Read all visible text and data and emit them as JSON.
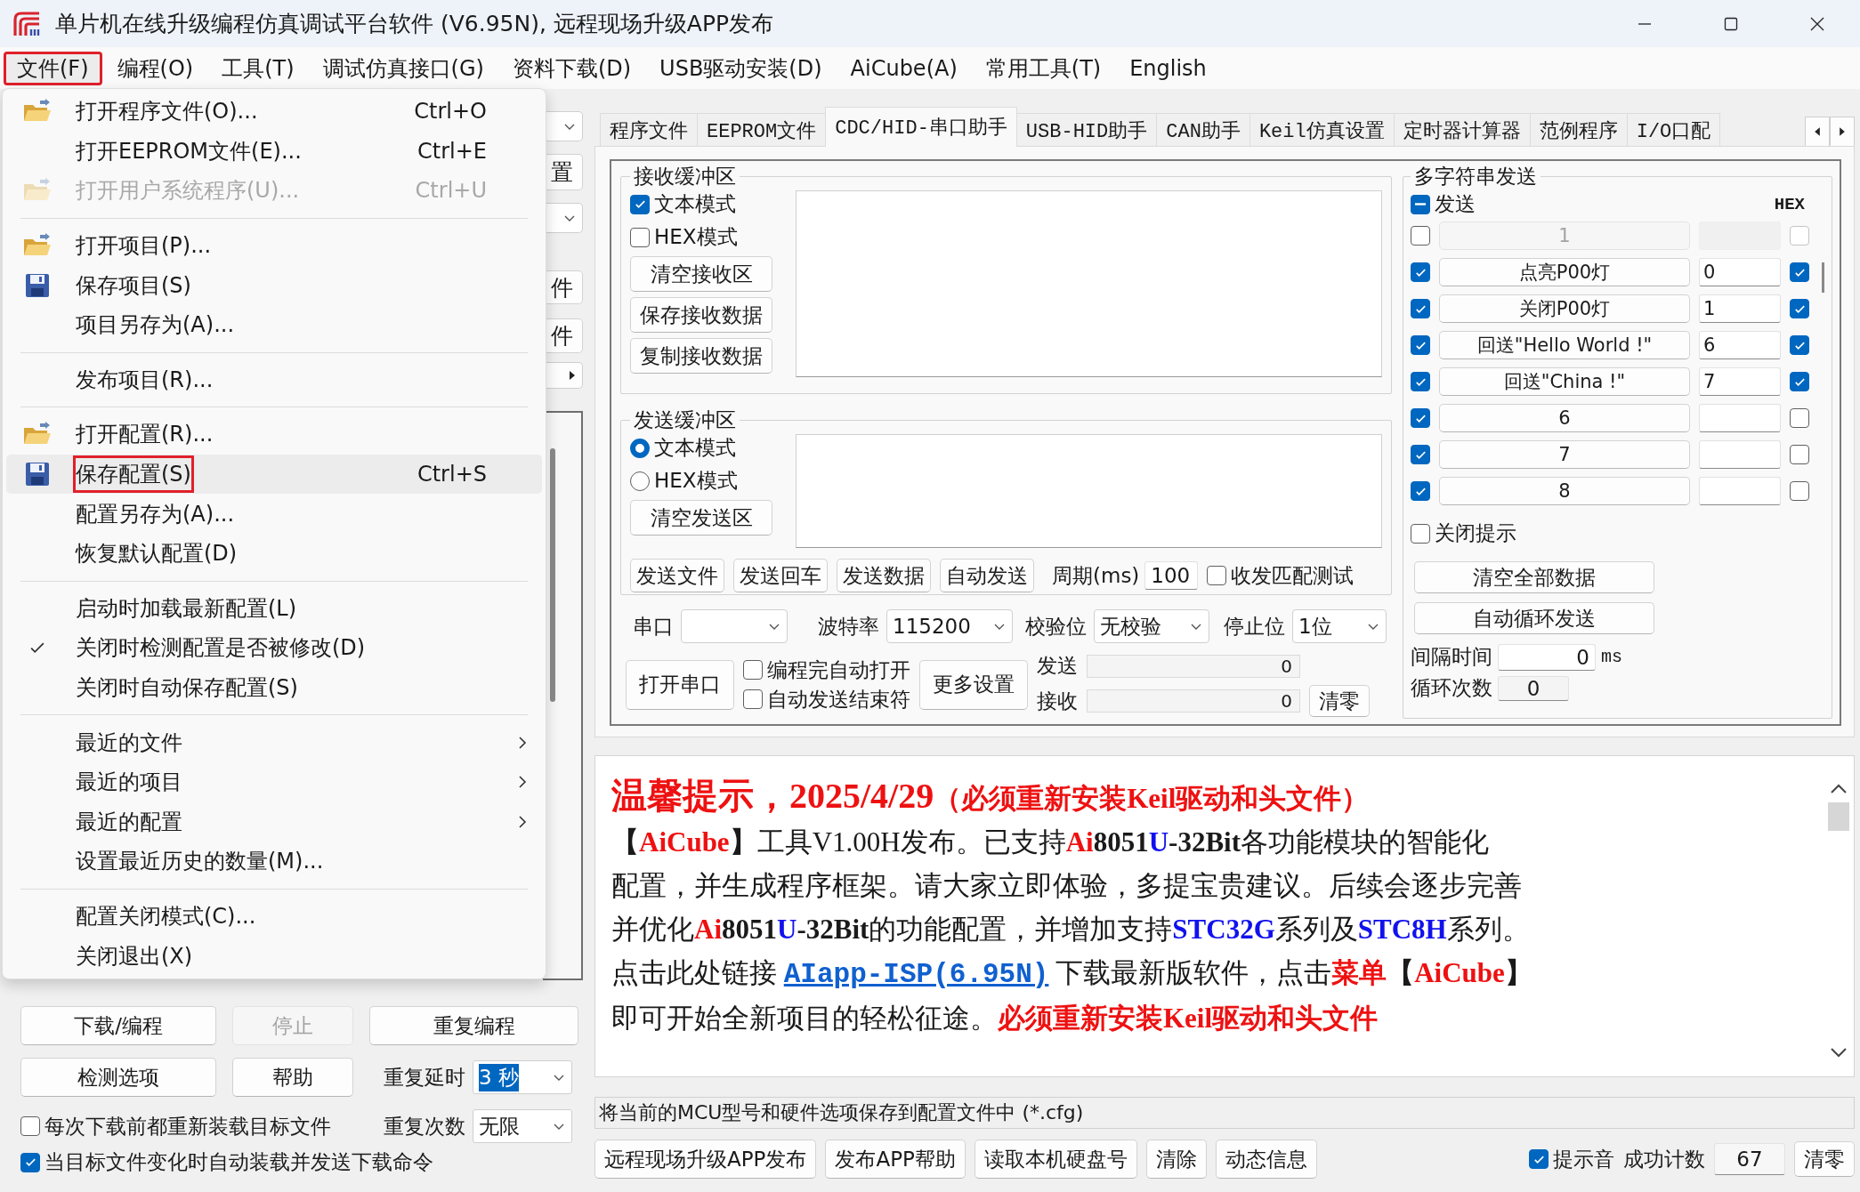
{
  "window": {
    "title": "单片机在线升级编程仿真调试平台软件 (V6.95N), 远程现场升级APP发布"
  },
  "menu_bar": [
    {
      "label": "文件(F)",
      "selected": true,
      "outlined": true
    },
    {
      "label": "编程(O)",
      "selected": false,
      "outlined": false
    },
    {
      "label": "工具(T)",
      "selected": false,
      "outlined": false
    },
    {
      "label": "调试仿真接口(G)",
      "selected": false,
      "outlined": false
    },
    {
      "label": "资料下载(D)",
      "selected": false,
      "outlined": false
    },
    {
      "label": "USB驱动安装(D)",
      "selected": false,
      "outlined": false
    },
    {
      "label": "AiCube(A)",
      "selected": false,
      "outlined": false
    },
    {
      "label": "常用工具(T)",
      "selected": false,
      "outlined": false
    },
    {
      "label": "English",
      "selected": false,
      "outlined": false
    }
  ],
  "file_menu": {
    "groups": [
      [
        {
          "label": "打开程序文件(O)...",
          "shortcut": "Ctrl+O",
          "kind": "open",
          "disabled": false,
          "checked": false,
          "submenu": false,
          "highlighted": false,
          "outlined": false
        },
        {
          "label": "打开EEPROM文件(E)...",
          "shortcut": "Ctrl+E",
          "kind": "plain",
          "disabled": false,
          "checked": false,
          "submenu": false,
          "highlighted": false,
          "outlined": false
        },
        {
          "label": "打开用户系统程序(U)...",
          "shortcut": "Ctrl+U",
          "kind": "open",
          "disabled": true,
          "checked": false,
          "submenu": false,
          "highlighted": false,
          "outlined": false
        }
      ],
      [
        {
          "label": "打开项目(P)...",
          "kind": "open",
          "disabled": false,
          "checked": false,
          "submenu": false,
          "highlighted": false,
          "outlined": false
        },
        {
          "label": "保存项目(S)",
          "kind": "save",
          "disabled": false,
          "checked": false,
          "submenu": false,
          "highlighted": false,
          "outlined": false
        },
        {
          "label": "项目另存为(A)...",
          "kind": "plain",
          "disabled": false,
          "checked": false,
          "submenu": false,
          "highlighted": false,
          "outlined": false
        }
      ],
      [
        {
          "label": "发布项目(R)...",
          "kind": "plain",
          "disabled": false,
          "checked": false,
          "submenu": false,
          "highlighted": false,
          "outlined": false
        }
      ],
      [
        {
          "label": "打开配置(R)...",
          "kind": "open",
          "disabled": false,
          "checked": false,
          "submenu": false,
          "highlighted": false,
          "outlined": false
        },
        {
          "label": "保存配置(S)",
          "shortcut": "Ctrl+S",
          "kind": "save",
          "disabled": false,
          "checked": false,
          "submenu": false,
          "highlighted": true,
          "outlined": true
        },
        {
          "label": "配置另存为(A)...",
          "kind": "plain",
          "disabled": false,
          "checked": false,
          "submenu": false,
          "highlighted": false,
          "outlined": false
        },
        {
          "label": "恢复默认配置(D)",
          "kind": "plain",
          "disabled": false,
          "checked": false,
          "submenu": false,
          "highlighted": false,
          "outlined": false
        }
      ],
      [
        {
          "label": "启动时加载最新配置(L)",
          "kind": "plain",
          "disabled": false,
          "checked": false,
          "submenu": false,
          "highlighted": false,
          "outlined": false
        },
        {
          "label": "关闭时检测配置是否被修改(D)",
          "kind": "plain",
          "disabled": false,
          "checked": true,
          "submenu": false,
          "highlighted": false,
          "outlined": false
        },
        {
          "label": "关闭时自动保存配置(S)",
          "kind": "plain",
          "disabled": false,
          "checked": false,
          "submenu": false,
          "highlighted": false,
          "outlined": false
        }
      ],
      [
        {
          "label": "最近的文件",
          "kind": "plain",
          "disabled": false,
          "checked": false,
          "submenu": true,
          "highlighted": false,
          "outlined": false
        },
        {
          "label": "最近的项目",
          "kind": "plain",
          "disabled": false,
          "checked": false,
          "submenu": true,
          "highlighted": false,
          "outlined": false
        },
        {
          "label": "最近的配置",
          "kind": "plain",
          "disabled": false,
          "checked": false,
          "submenu": true,
          "highlighted": false,
          "outlined": false
        },
        {
          "label": "设置最近历史的数量(M)...",
          "kind": "plain",
          "disabled": false,
          "checked": false,
          "submenu": false,
          "highlighted": false,
          "outlined": false
        }
      ],
      [
        {
          "label": "配置关闭模式(C)...",
          "kind": "plain",
          "disabled": false,
          "checked": false,
          "submenu": false,
          "highlighted": false,
          "outlined": false
        },
        {
          "label": "关闭退出(X)",
          "kind": "plain",
          "disabled": false,
          "checked": false,
          "submenu": false,
          "highlighted": false,
          "outlined": false
        }
      ]
    ]
  },
  "left_panel": {
    "partial_buttons": [
      "置",
      "件",
      "件"
    ],
    "program_buttons": [
      {
        "label": "下载/编程",
        "disabled": false
      },
      {
        "label": "停止",
        "disabled": true
      },
      {
        "label": "重复编程",
        "disabled": false
      },
      {
        "label": "检测选项",
        "disabled": false
      },
      {
        "label": "帮助",
        "disabled": false
      }
    ],
    "repeat": [
      {
        "label": "重复延时",
        "value": "3 秒",
        "highlighted": true
      },
      {
        "label": "重复次数",
        "value": "无限",
        "highlighted": false
      }
    ],
    "options": [
      {
        "label": "每次下载前都重新装载目标文件",
        "checked": false
      },
      {
        "label": "当目标文件变化时自动装载并发送下载命令",
        "checked": true
      }
    ]
  },
  "tabs": [
    {
      "label": "程序文件",
      "selected": false
    },
    {
      "label": "EEPROM文件",
      "selected": false
    },
    {
      "label": "CDC/HID-串口助手",
      "selected": true
    },
    {
      "label": "USB-HID助手",
      "selected": false
    },
    {
      "label": "CAN助手",
      "selected": false
    },
    {
      "label": "Keil仿真设置",
      "selected": false
    },
    {
      "label": "定时器计算器",
      "selected": false
    },
    {
      "label": "范例程序",
      "selected": false
    },
    {
      "label": "I/O口配",
      "selected": false
    }
  ],
  "serial": {
    "receive_buffer": {
      "title": "接收缓冲区",
      "modes": [
        {
          "label": "文本模式",
          "checked": true
        },
        {
          "label": "HEX模式",
          "checked": false
        }
      ],
      "buttons": [
        "清空接收区",
        "保存接收数据",
        "复制接收数据"
      ]
    },
    "send_buffer": {
      "title": "发送缓冲区",
      "modes": [
        {
          "label": "文本模式",
          "selected": true
        },
        {
          "label": "HEX模式",
          "selected": false
        }
      ],
      "buttons": [
        "清空发送区"
      ],
      "actions": [
        "发送文件",
        "发送回车",
        "发送数据",
        "自动发送"
      ],
      "period": {
        "label": "周期(ms)",
        "value": "100"
      },
      "match_test": {
        "label": "收发匹配测试",
        "checked": false
      }
    },
    "port_settings": [
      {
        "label": "串口"
      },
      {
        "label": "波特率",
        "value": "115200"
      },
      {
        "label": "校验位",
        "value": "无校验"
      },
      {
        "label": "停止位",
        "value": "1位"
      }
    ],
    "open_port": "打开串口",
    "port_options": [
      {
        "label": "编程完自动打开",
        "checked": false
      },
      {
        "label": "自动发送结束符",
        "checked": false
      }
    ],
    "more_settings": "更多设置",
    "counters": [
      {
        "label": "发送",
        "value": "0"
      },
      {
        "label": "接收",
        "value": "0"
      }
    ],
    "reset": "清零"
  },
  "multi_send": {
    "title": "多字符串发送",
    "send_all": {
      "label": "发送",
      "indeterminate": true
    },
    "hex_header": "HEX",
    "rows": [
      {
        "checked": false,
        "label": "1",
        "disabled": true,
        "hex": false
      },
      {
        "checked": true,
        "label": "点亮P00灯",
        "value": "0",
        "disabled": false,
        "hex": true
      },
      {
        "checked": true,
        "label": "关闭P00灯",
        "value": "1",
        "disabled": false,
        "hex": true
      },
      {
        "checked": true,
        "label": "回送\"Hello World !\"",
        "value": "6",
        "disabled": false,
        "hex": true
      },
      {
        "checked": true,
        "label": "回送\"China !\"",
        "value": "7",
        "disabled": false,
        "hex": true
      },
      {
        "checked": true,
        "label": "6",
        "disabled": false,
        "hex": false
      },
      {
        "checked": true,
        "label": "7",
        "disabled": false,
        "hex": false
      },
      {
        "checked": true,
        "label": "8",
        "disabled": false,
        "hex": false
      }
    ],
    "close_hint": {
      "label": "关闭提示",
      "checked": false
    },
    "buttons": [
      "清空全部数据",
      "自动循环发送"
    ],
    "interval": {
      "label": "间隔时间",
      "value": "0",
      "unit": "ms"
    },
    "loop_count": {
      "label": "循环次数",
      "value": "0"
    }
  },
  "news": {
    "heading": [
      {
        "text": "温馨提示，2025/4/29",
        "kind": "title"
      },
      {
        "text": "（必须重新安装Keil驱动和头文件）",
        "kind": "red"
      }
    ],
    "body": [
      {
        "text": "【",
        "kind": "bold"
      },
      {
        "text": "AiCube",
        "kind": "red"
      },
      {
        "text": "】",
        "kind": "bold"
      },
      {
        "text": "工具V1.00H发布。已支持",
        "kind": "plain"
      },
      {
        "text": "Ai",
        "kind": "red"
      },
      {
        "text": "8051",
        "kind": "bold"
      },
      {
        "text": "U",
        "kind": "blue"
      },
      {
        "text": "-32Bit",
        "kind": "bold"
      },
      {
        "text": "各功能模块的智能化",
        "kind": "plain"
      },
      {
        "kind": "break"
      },
      {
        "text": "配置，并生成程序框架。请大家立即体验，多提宝贵建议。后续会逐步完善",
        "kind": "plain"
      },
      {
        "kind": "break"
      },
      {
        "text": "并优化",
        "kind": "plain"
      },
      {
        "text": "Ai",
        "kind": "red"
      },
      {
        "text": "8051",
        "kind": "bold"
      },
      {
        "text": "U",
        "kind": "blue"
      },
      {
        "text": "-32Bit",
        "kind": "bold"
      },
      {
        "text": "的功能配置，并增加支持",
        "kind": "plain"
      },
      {
        "text": "STC32G",
        "kind": "blue"
      },
      {
        "text": "系列及",
        "kind": "plain"
      },
      {
        "text": "STC8H",
        "kind": "blue"
      },
      {
        "text": "系列。",
        "kind": "plain"
      },
      {
        "kind": "break"
      },
      {
        "text": "点击此处链接 ",
        "kind": "plain"
      },
      {
        "text": "AIapp-ISP(6.95N)",
        "kind": "link"
      },
      {
        "text": " 下载最新版软件，点击",
        "kind": "plain"
      },
      {
        "text": "菜单",
        "kind": "red"
      },
      {
        "text": "【",
        "kind": "bold"
      },
      {
        "text": "AiCube",
        "kind": "red"
      },
      {
        "text": "】",
        "kind": "bold"
      },
      {
        "kind": "break"
      },
      {
        "text": "即可开始全新项目的轻松征途。",
        "kind": "plain"
      },
      {
        "text": "必须重新安装Keil驱动和头文件",
        "kind": "red"
      }
    ]
  },
  "status_text": "将当前的MCU型号和硬件选项保存到配置文件中 (*.cfg)",
  "footer": {
    "buttons": [
      "远程现场升级APP发布",
      "发布APP帮助",
      "读取本机硬盘号",
      "清除",
      "动态信息"
    ],
    "beep": {
      "label": "提示音",
      "checked": true
    },
    "success_count": {
      "label": "成功计数",
      "value": "67"
    },
    "reset": "清零"
  }
}
